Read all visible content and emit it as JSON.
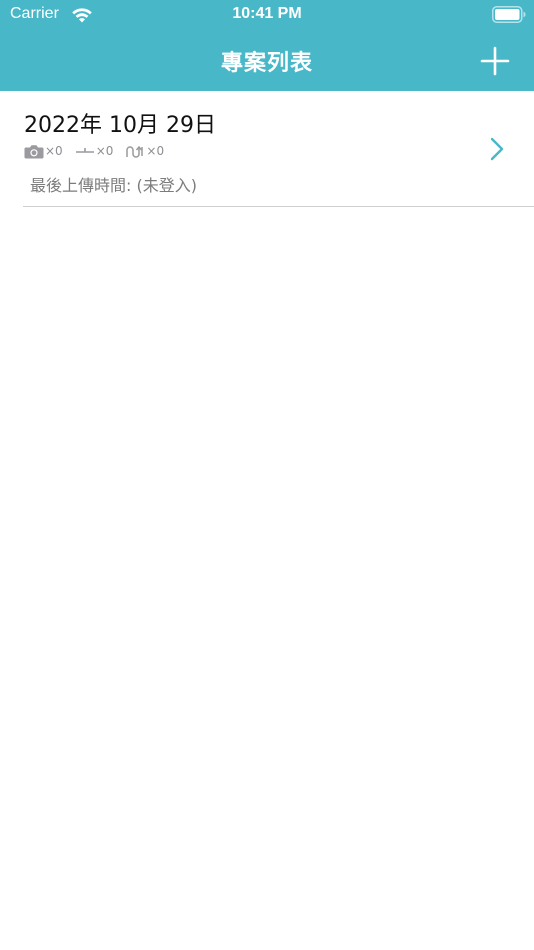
{
  "status_bar": {
    "carrier": "Carrier",
    "time": "10:41 PM"
  },
  "nav": {
    "title": "專案列表",
    "add_icon": "plus-icon",
    "color": "#48b8c9"
  },
  "projects": [
    {
      "title": "2022年 10月 29日",
      "photo_count": "×0",
      "measure_count": "×0",
      "curve_count": "×0",
      "last_upload": "最後上傳時間: (未登入)"
    }
  ]
}
